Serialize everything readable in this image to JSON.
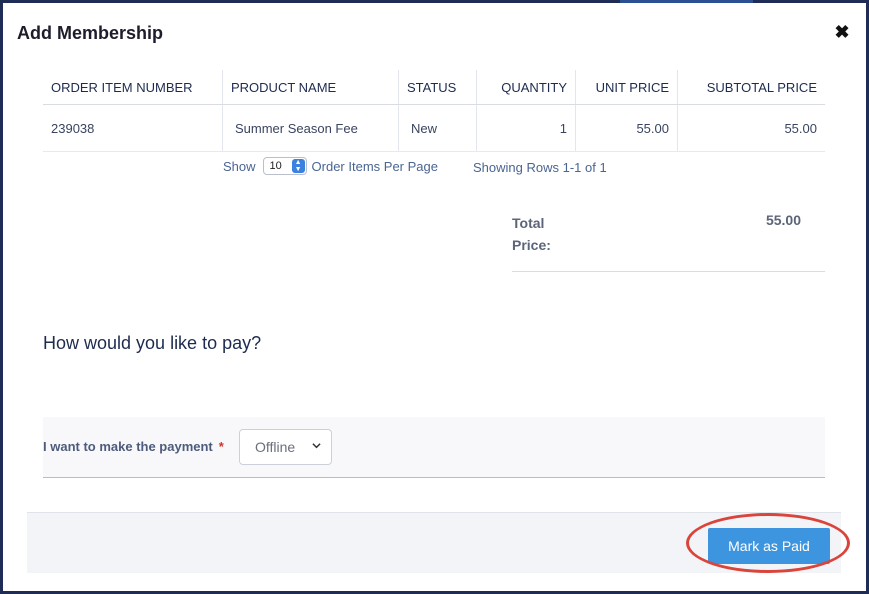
{
  "modal": {
    "title": "Add Membership",
    "close_icon": "close-icon"
  },
  "order_table": {
    "headers": [
      "ORDER ITEM NUMBER",
      "PRODUCT NAME",
      "STATUS",
      "QUANTITY",
      "UNIT PRICE",
      "SUBTOTAL PRICE"
    ],
    "rows": [
      [
        "239038",
        "Summer Season Fee",
        "New",
        "1",
        "55.00",
        "55.00"
      ]
    ]
  },
  "pagination": {
    "show_label": "Show",
    "per_page_value": "10",
    "per_page_suffix": "Order Items Per Page",
    "rows_info": "Showing Rows 1-1 of 1"
  },
  "total": {
    "label": "Total Price:",
    "value": "55.00"
  },
  "payment": {
    "heading": "How would you like to pay?",
    "field_label": "I want to make the payment",
    "required_marker": "*",
    "selected_option": "Offline"
  },
  "footer": {
    "mark_paid_label": "Mark as Paid"
  },
  "colors": {
    "accent": "#3d95df",
    "highlight": "#d9443b"
  }
}
